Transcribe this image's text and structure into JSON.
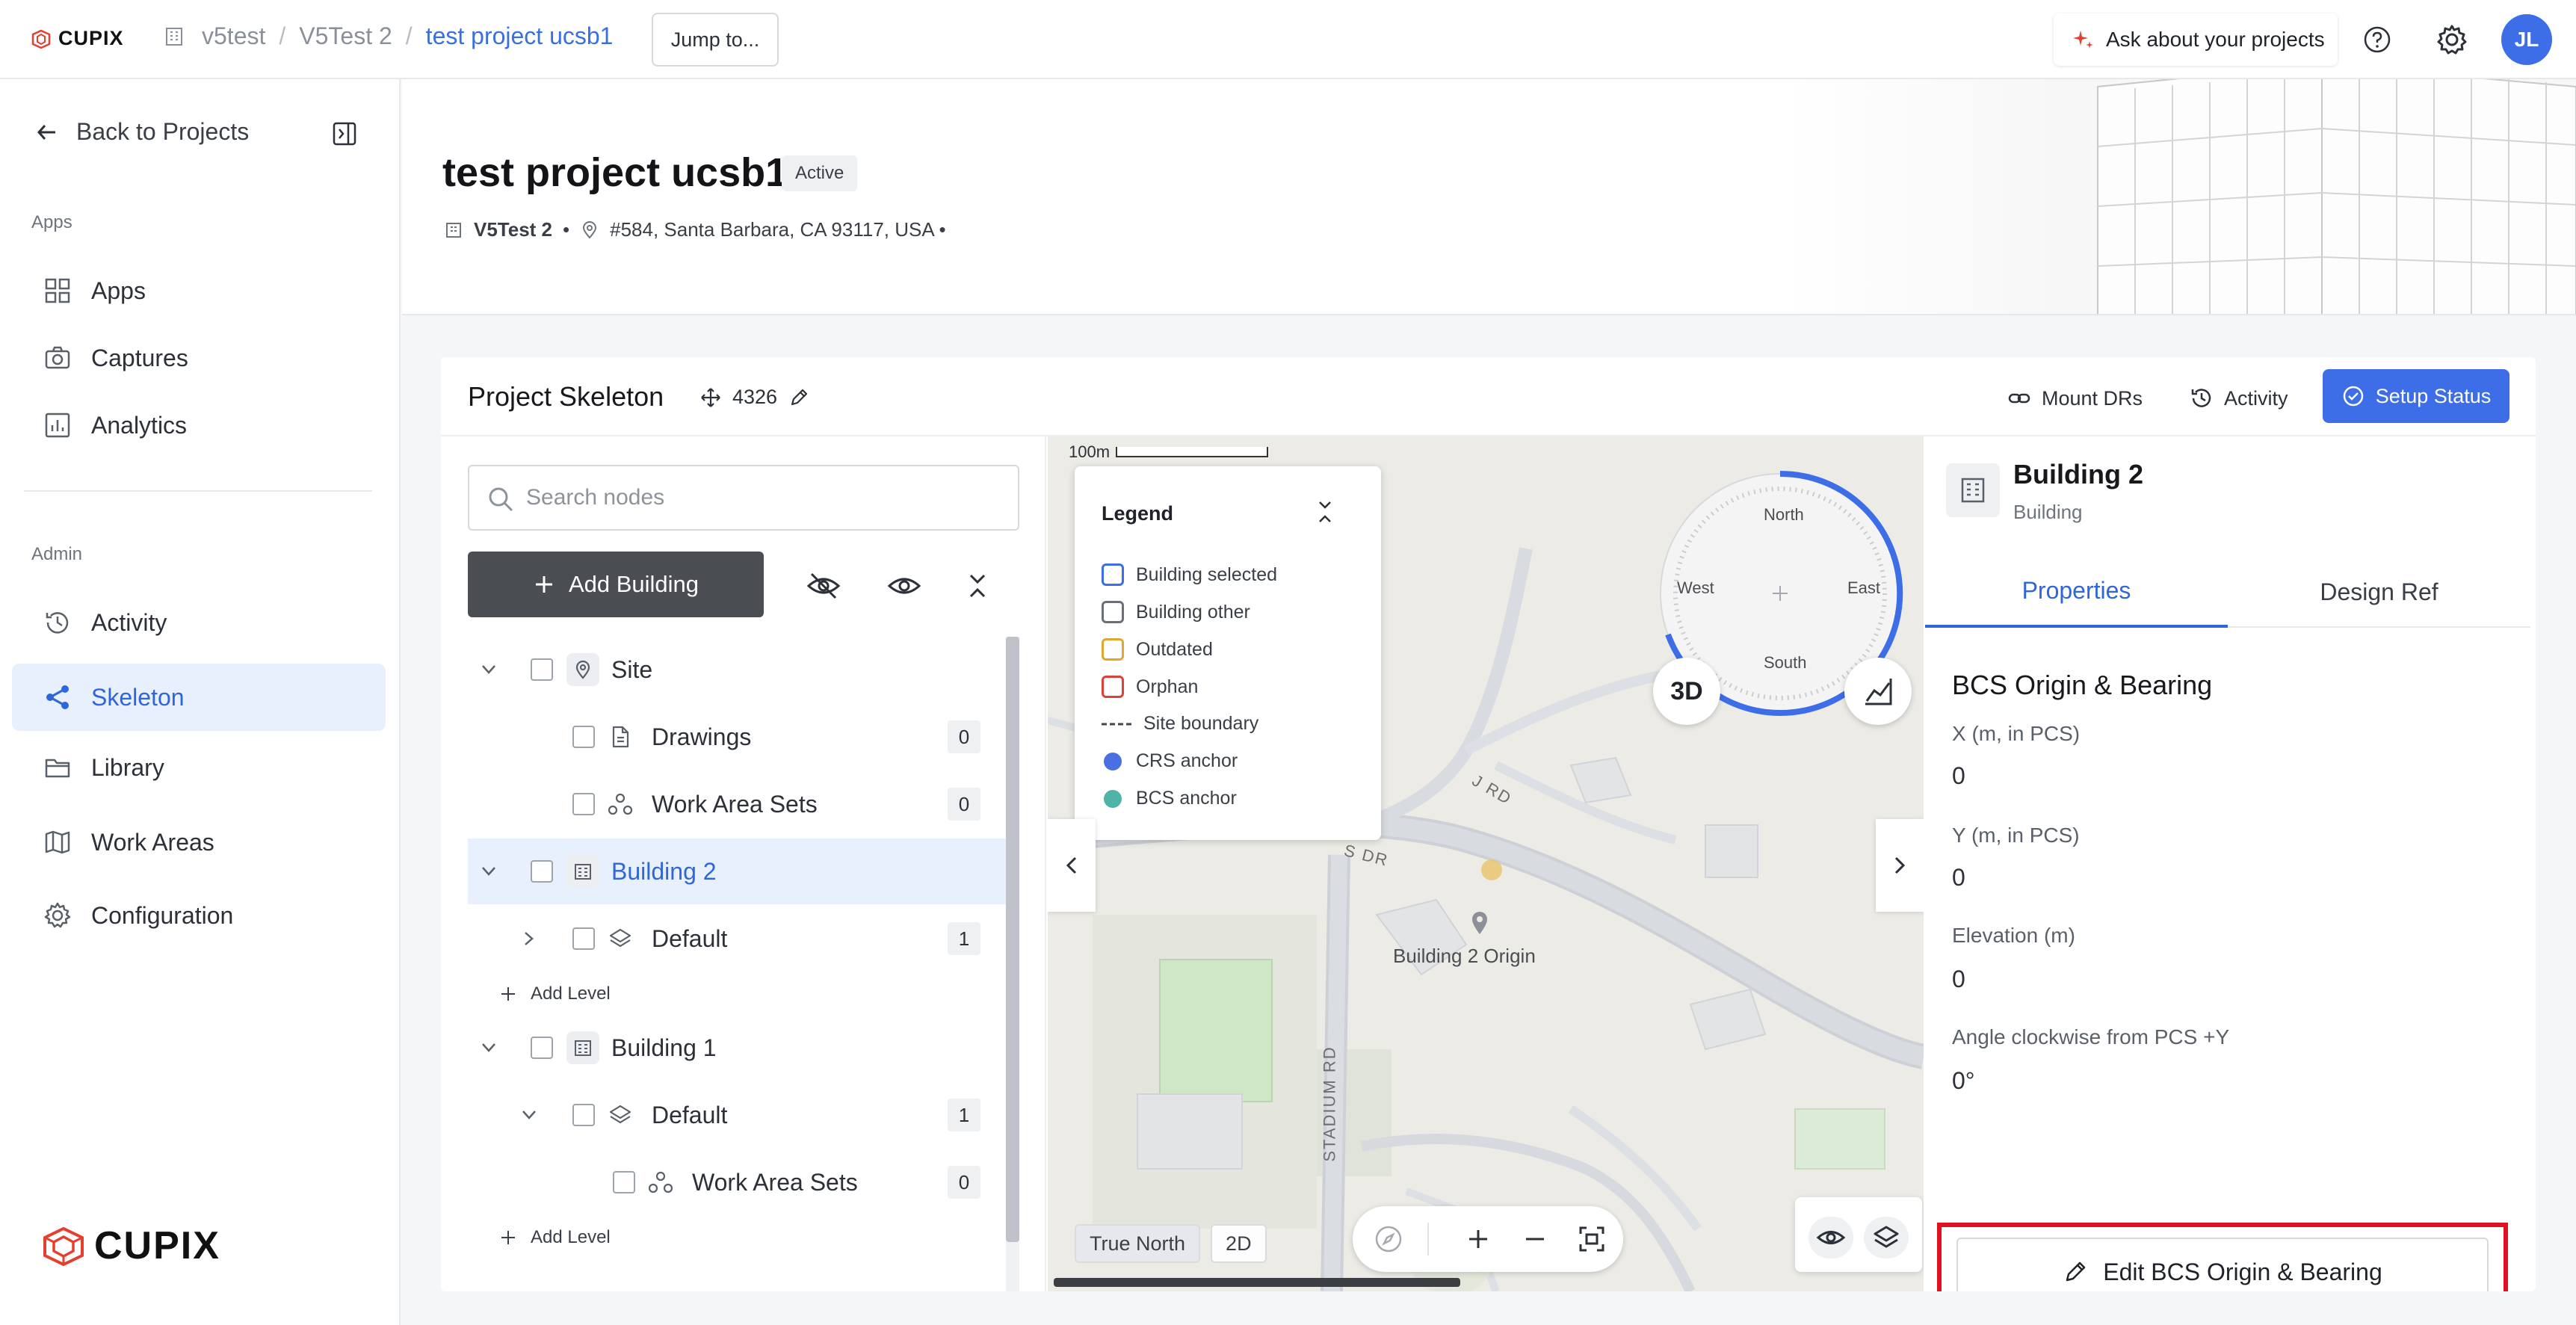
{
  "topbar": {
    "logo_text": "CUPIX",
    "breadcrumbs": [
      "v5test",
      "V5Test 2",
      "test project ucsb1"
    ],
    "jump_label": "Jump to...",
    "ask_label": "Ask about your projects",
    "avatar_initials": "JL",
    "icons": [
      "help-icon",
      "gear-icon"
    ]
  },
  "sidebar": {
    "back_label": "Back to Projects",
    "apps_section": "Apps",
    "apps_items": [
      {
        "label": "Apps",
        "icon": "grid-icon"
      },
      {
        "label": "Captures",
        "icon": "camera-icon"
      },
      {
        "label": "Analytics",
        "icon": "chart-icon"
      }
    ],
    "admin_section": "Admin",
    "admin_items": [
      {
        "label": "Activity",
        "icon": "history-icon"
      },
      {
        "label": "Skeleton",
        "icon": "skeleton-icon",
        "active": true
      },
      {
        "label": "Library",
        "icon": "folder-icon"
      },
      {
        "label": "Work Areas",
        "icon": "map-icon"
      },
      {
        "label": "Configuration",
        "icon": "gear-icon"
      }
    ],
    "footer_logo_text": "CUPIX"
  },
  "project": {
    "title": "test project ucsb1",
    "status": "Active",
    "workspace": "V5Test 2",
    "meta_separator": "•",
    "address": "#584, Santa Barbara, CA 93117, USA •"
  },
  "skeleton": {
    "title": "Project Skeleton",
    "epsg": "4326",
    "mount_label": "Mount DRs",
    "activity_label": "Activity",
    "setup_label": "Setup Status",
    "search_placeholder": "Search nodes",
    "add_building_label": "Add Building",
    "add_level_label": "Add Level",
    "tree": {
      "site": {
        "label": "Site"
      },
      "drawings": {
        "label": "Drawings",
        "count": "0"
      },
      "work_area_sets": {
        "label": "Work Area Sets",
        "count": "0"
      },
      "building2": {
        "label": "Building 2",
        "selected": true
      },
      "building2_default": {
        "label": "Default",
        "count": "1"
      },
      "building1": {
        "label": "Building 1"
      },
      "building1_default": {
        "label": "Default",
        "count": "1"
      },
      "building1_was": {
        "label": "Work Area Sets",
        "count": "0"
      }
    }
  },
  "map": {
    "scale_label": "100m",
    "legend": {
      "title": "Legend",
      "items": [
        {
          "label": "Building selected",
          "color": "#3d6ee8",
          "kind": "box"
        },
        {
          "label": "Building other",
          "color": "#6b7078",
          "kind": "box"
        },
        {
          "label": "Outdated",
          "color": "#e0a733",
          "kind": "box"
        },
        {
          "label": "Orphan",
          "color": "#e0403a",
          "kind": "box"
        },
        {
          "label": "Site boundary",
          "color": "#444",
          "kind": "dash"
        },
        {
          "label": "CRS anchor",
          "color": "#4a6fe3",
          "kind": "dot"
        },
        {
          "label": "BCS anchor",
          "color": "#4fb3a8",
          "kind": "dot"
        }
      ]
    },
    "compass": {
      "north": "North",
      "south": "South",
      "east": "East",
      "west": "West"
    },
    "mode_3d": "3D",
    "road_labels": [
      "J RD",
      "S DR",
      "STADIUM RD"
    ],
    "origin_label": "Building 2 Origin",
    "true_north_label": "True North",
    "mode_2d": "2D"
  },
  "properties": {
    "title": "Building 2",
    "subtitle": "Building",
    "tabs": [
      "Properties",
      "Design Ref"
    ],
    "section_title": "BCS Origin & Bearing",
    "fields": [
      {
        "label": "X (m, in PCS)",
        "value": "0"
      },
      {
        "label": "Y (m, in PCS)",
        "value": "0"
      },
      {
        "label": "Elevation (m)",
        "value": "0"
      },
      {
        "label": "Angle clockwise from PCS +Y",
        "value": "0°"
      }
    ],
    "edit_label": "Edit BCS Origin & Bearing",
    "highlight_color": "#e0121f"
  }
}
